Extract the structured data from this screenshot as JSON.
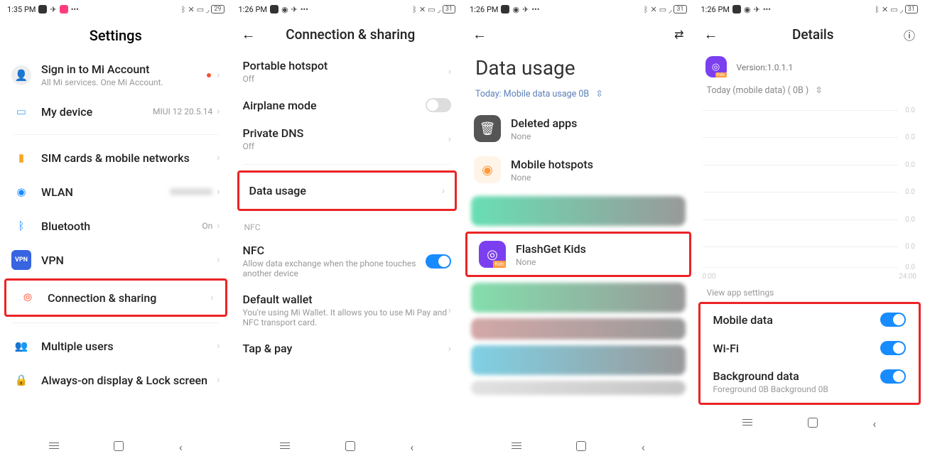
{
  "screens": {
    "s1": {
      "status": {
        "time": "1:35 PM",
        "battery": "29"
      },
      "title": "Settings",
      "signin": {
        "title": "Sign in to Mi Account",
        "sub": "All Mi services. One Mi Account."
      },
      "mydevice": {
        "title": "My device",
        "right": "MIUI 12 20.5.14"
      },
      "sim": {
        "title": "SIM cards & mobile networks"
      },
      "wlan": {
        "title": "WLAN"
      },
      "bt": {
        "title": "Bluetooth",
        "right": "On"
      },
      "vpn": {
        "title": "VPN"
      },
      "conn": {
        "title": "Connection & sharing"
      },
      "multi": {
        "title": "Multiple users"
      },
      "aod": {
        "title": "Always-on display & Lock screen"
      }
    },
    "s2": {
      "status": {
        "time": "1:26 PM",
        "battery": "31"
      },
      "title": "Connection & sharing",
      "hotspot": {
        "title": "Portable hotspot",
        "sub": "Off"
      },
      "airplane": {
        "title": "Airplane mode"
      },
      "dns": {
        "title": "Private DNS",
        "sub": "Off"
      },
      "data": {
        "title": "Data usage"
      },
      "nfc_section": "NFC",
      "nfc": {
        "title": "NFC",
        "sub": "Allow data exchange when the phone touches another device"
      },
      "wallet": {
        "title": "Default wallet",
        "sub": "You're using Mi Wallet. It allows you to use Mi Pay and NFC transport card."
      },
      "tap": {
        "title": "Tap & pay"
      }
    },
    "s3": {
      "status": {
        "time": "1:26 PM",
        "battery": "31"
      },
      "title": "Data usage",
      "filter": "Today: Mobile data usage 0B",
      "deleted": {
        "title": "Deleted apps",
        "sub": "None"
      },
      "hotspots": {
        "title": "Mobile hotspots",
        "sub": "None"
      },
      "flashget": {
        "title": "FlashGet Kids",
        "sub": "None"
      }
    },
    "s4": {
      "status": {
        "time": "1:26 PM",
        "battery": "31"
      },
      "title": "Details",
      "version": "Version:1.0.1.1",
      "filter": "Today (mobile data) ( 0B )",
      "chart_ylabel": "0.0",
      "chart_x0": "0:00",
      "chart_x1": "24:00",
      "view_settings": "View app settings",
      "mobile": {
        "title": "Mobile data"
      },
      "wifi": {
        "title": "Wi-Fi"
      },
      "bgdata": {
        "title": "Background data",
        "sub": "Foreground 0B  Background 0B"
      }
    }
  },
  "chart_data": {
    "type": "line",
    "title": "Today (mobile data) ( 0B )",
    "xlabel": "",
    "ylabel": "",
    "x_range": [
      "0:00",
      "24:00"
    ],
    "y_ticks": [
      0.0,
      0.0,
      0.0,
      0.0,
      0.0,
      0.0,
      0.0
    ],
    "series": [
      {
        "name": "mobile data",
        "values": []
      }
    ]
  }
}
